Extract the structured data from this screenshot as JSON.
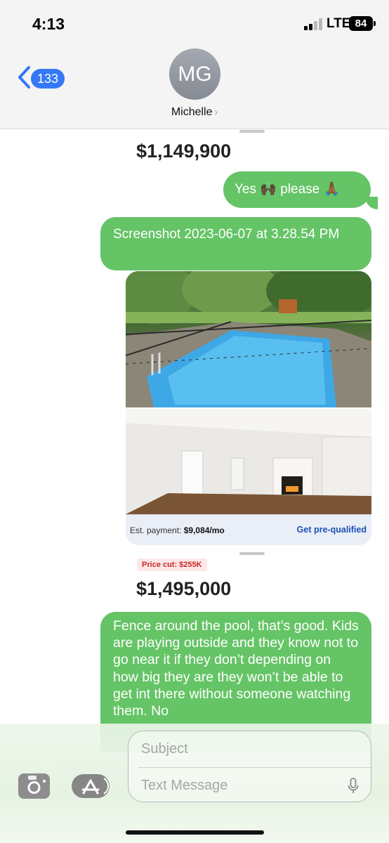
{
  "status_bar": {
    "time": "4:13",
    "network": "LTE",
    "battery": "84"
  },
  "header": {
    "back_count": "133",
    "avatar_initials": "MG",
    "contact_name": "Michelle"
  },
  "messages": {
    "price_top": "$1,149,900",
    "reply_yes": "Yes 🙌🏿 please 🙏🏾",
    "file_name": "Screenshot 2023-06-07 at 3.28.54 PM",
    "listing": {
      "est_payment_label": "Est. payment:",
      "est_payment_value": "$9,084/mo",
      "prequal_link": "Get pre-qualified"
    },
    "price_cut": "Price cut: $255K",
    "price_bottom": "$1,495,000",
    "long_message": "Fence around the pool, that’s good. Kids are playing outside and they know not to go near it if they don’t depending on how big they are they won’t be able to get int there without someone watching them. No"
  },
  "composer": {
    "subject_placeholder": "Subject",
    "message_placeholder": "Text Message"
  },
  "colors": {
    "imessage_green": "#65c466",
    "ios_blue": "#3478f6",
    "header_bg": "#f4f4f4"
  },
  "icons": [
    "signal-icon",
    "battery-icon",
    "back-chevron-icon",
    "camera-icon",
    "app-store-icon",
    "mic-icon"
  ]
}
